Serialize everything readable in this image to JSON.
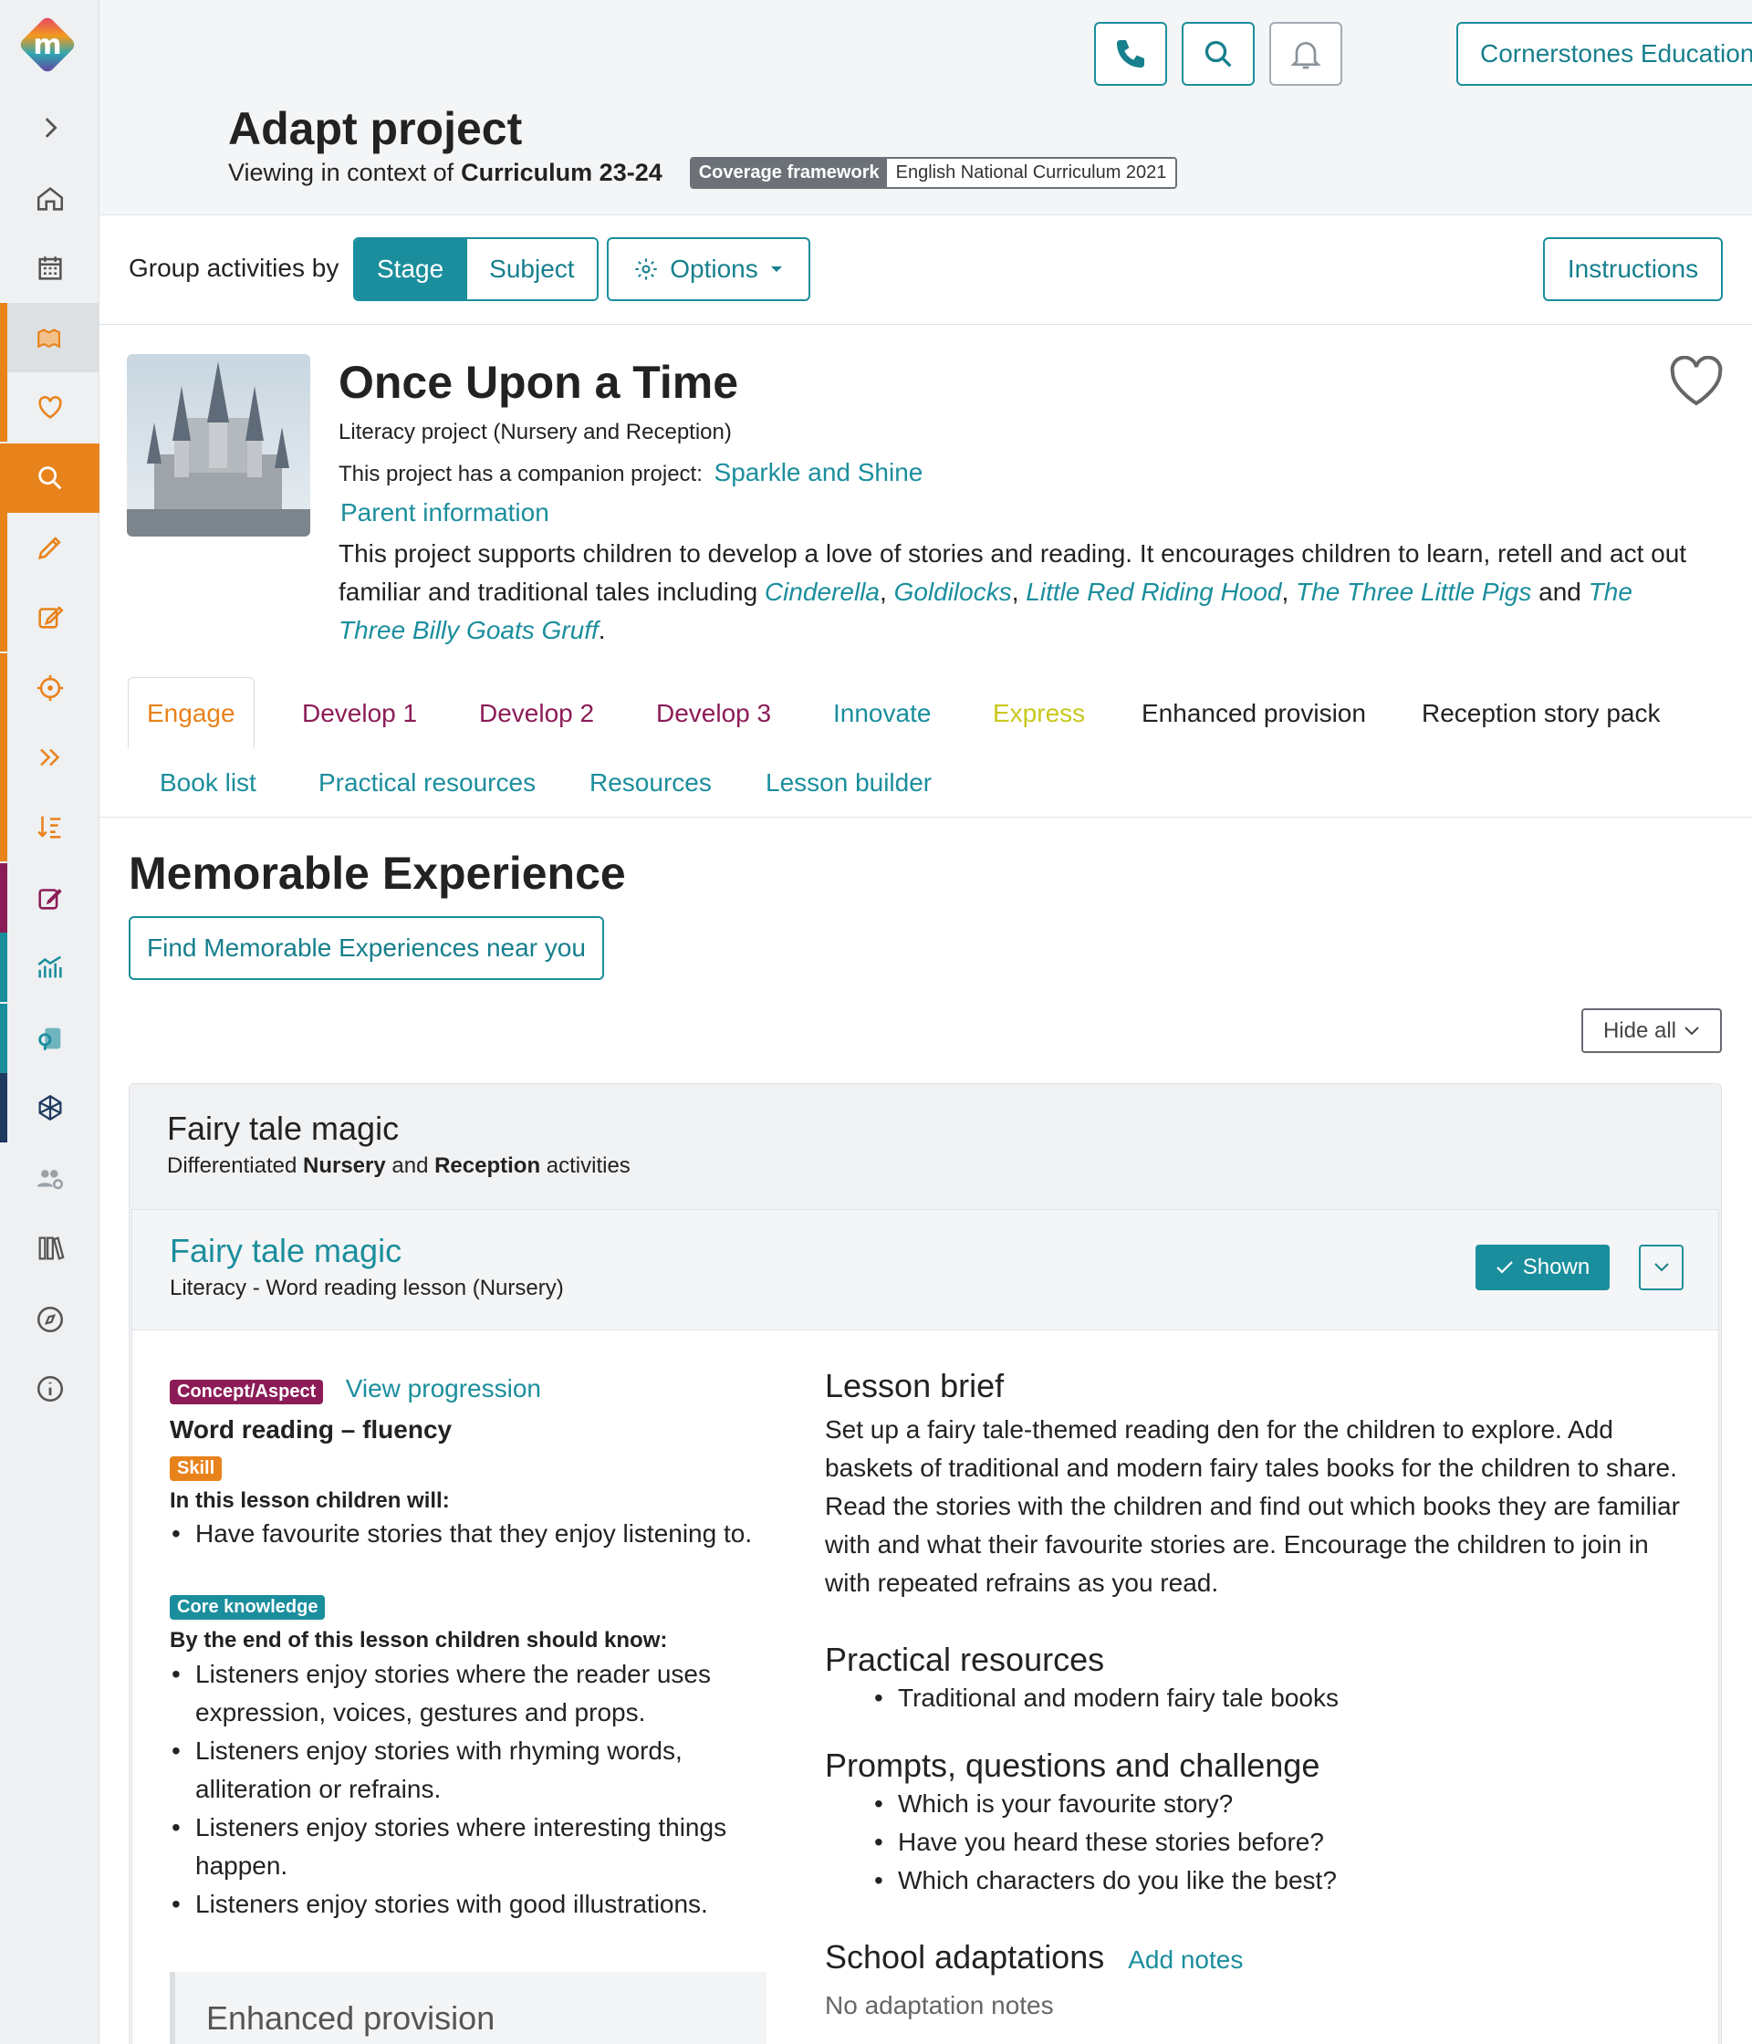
{
  "header": {
    "school_name": "Cornerstones Education",
    "page_title": "Adapt project",
    "context_prefix": "Viewing in context of",
    "context_value": "Curriculum 23-24",
    "coverage_key": "Coverage framework",
    "coverage_value": "English National Curriculum 2021"
  },
  "toolbar": {
    "group_label": "Group activities by",
    "stage_label": "Stage",
    "subject_label": "Subject",
    "options_label": "Options",
    "instructions_label": "Instructions"
  },
  "project": {
    "title": "Once Upon a Time",
    "subtitle": "Literacy project (Nursery and Reception)",
    "companion_prefix": "This project has a companion project:",
    "companion_link": "Sparkle and Shine",
    "parent_info": "Parent information",
    "desc_1": "This project supports children to develop a love of stories and reading. It encourages children to learn, retell and act out familiar and traditional tales including ",
    "tale_1": "Cinderella",
    "tale_2": "Goldilocks",
    "tale_3": "Little Red Riding Hood",
    "tale_4": "The Three Little Pigs",
    "and_word": "and",
    "tale_5": "The Three Billy Goats Gruff",
    "comma": ",",
    "period": "."
  },
  "tabs": {
    "engage": "Engage",
    "develop1": "Develop 1",
    "develop2": "Develop 2",
    "develop3": "Develop 3",
    "innovate": "Innovate",
    "express": "Express",
    "enhanced": "Enhanced provision",
    "story_pack": "Reception story pack",
    "book_list": "Book list",
    "practical": "Practical resources",
    "resources": "Resources",
    "lesson_builder": "Lesson builder"
  },
  "memorable": {
    "title": "Memorable Experience",
    "find_button": "Find Memorable Experiences near you",
    "hide_all": "Hide all"
  },
  "group_card": {
    "title": "Fairy tale magic",
    "sub_prefix": "Differentiated",
    "sub_nursery": "Nursery",
    "sub_and": "and",
    "sub_reception": "Reception",
    "sub_suffix": "activities"
  },
  "lesson": {
    "title": "Fairy tale magic",
    "subtitle": "Literacy - Word reading lesson (Nursery)",
    "shown_label": "Shown",
    "concept_badge": "Concept/Aspect",
    "view_progression": "View progression",
    "concept_name": "Word reading – fluency",
    "skill_badge": "Skill",
    "will_heading": "In this lesson children will:",
    "will_items": [
      "Have favourite stories that they enjoy listening to."
    ],
    "core_badge": "Core knowledge",
    "know_heading": "By the end of this lesson children should know:",
    "know_items": [
      "Listeners enjoy stories where the reader uses expression, voices, gestures and props.",
      "Listeners enjoy stories with rhyming words, alliteration or refrains.",
      "Listeners enjoy stories where interesting things happen.",
      "Listeners enjoy stories with good illustrations."
    ],
    "enhanced_title": "Enhanced provision",
    "brief_title": "Lesson brief",
    "brief_text": "Set up a fairy tale-themed reading den for the children to explore. Add baskets of traditional and modern fairy tales books for the children to share. Read the stories with the children and find out which books they are familiar with and what their favourite stories are. Encourage the children to join in with repeated refrains as you read.",
    "practical_title": "Practical resources",
    "practical_items": [
      "Traditional and modern fairy tale books"
    ],
    "prompts_title": "Prompts, questions and challenge",
    "prompts_items": [
      "Which is your favourite story?",
      "Have you heard these stories before?",
      "Which characters do you like the best?"
    ],
    "adapt_title": "School adaptations",
    "add_notes": "Add notes",
    "no_notes": "No adaptation notes"
  },
  "colors": {
    "teal": "#1b8e9d",
    "orange": "#e8821b",
    "plum": "#8c1c57",
    "lime": "#c8c81e"
  }
}
